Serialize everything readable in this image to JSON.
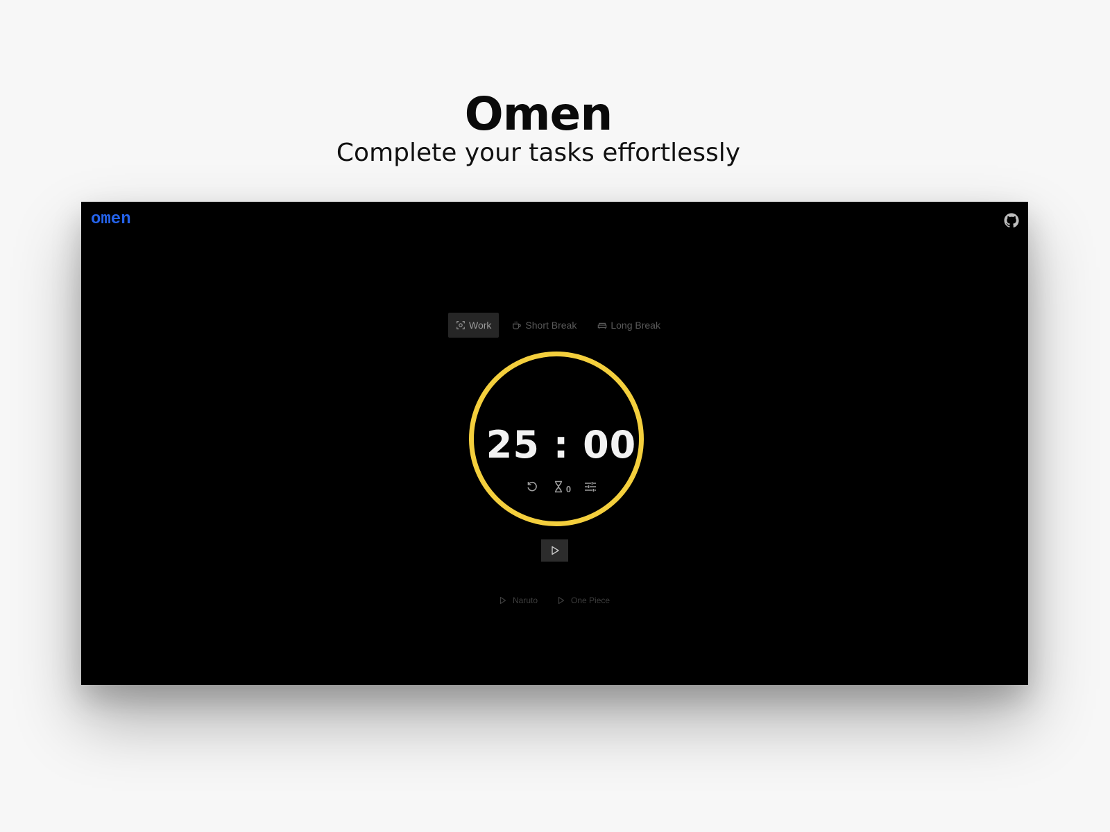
{
  "hero": {
    "title": "Omen",
    "subtitle": "Complete your tasks effortlessly"
  },
  "app": {
    "logo": "omen",
    "header_icon": "github-icon",
    "tabs": [
      {
        "label": "Work",
        "icon": "focus-icon",
        "active": true
      },
      {
        "label": "Short Break",
        "icon": "coffee-cup-icon",
        "active": false
      },
      {
        "label": "Long Break",
        "icon": "sofa-icon",
        "active": false
      }
    ],
    "timer": {
      "display": "25 : 00",
      "session_count": "0",
      "ring_color": "#f4cf3d"
    },
    "controls": [
      "reset-icon",
      "hourglass-icon",
      "settings-sliders-icon"
    ],
    "play_icon": "play-icon",
    "music": [
      {
        "label": "Naruto",
        "icon": "play-icon"
      },
      {
        "label": "One Piece",
        "icon": "play-icon"
      }
    ]
  },
  "colors": {
    "page_bg": "#f7f7f7",
    "app_bg": "#000000",
    "logo": "#2563eb",
    "accent": "#f4cf3d"
  }
}
